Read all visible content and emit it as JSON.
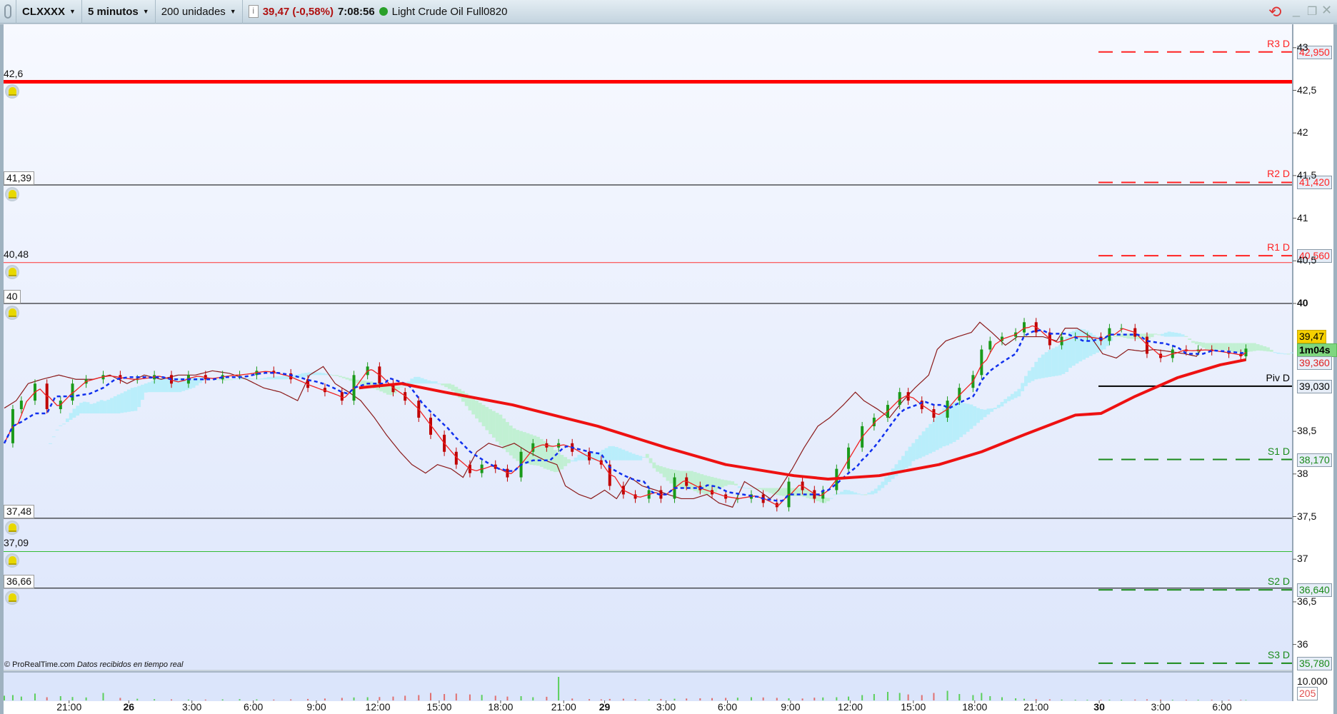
{
  "toolbar": {
    "symbol": "CLXXXX",
    "timeframe": "5 minutos",
    "units": "200 unidades",
    "price": "39,47 (-0,58%)",
    "time": "7:08:56",
    "instrument": "Light Crude Oil Full0820",
    "icons": [
      "link-icon",
      "info-icon",
      "status-dot-icon",
      "refresh-icon",
      "minimize-icon",
      "restore-icon",
      "close-icon"
    ]
  },
  "colors": {
    "up": "#1a9a1a",
    "down": "#c00000",
    "sma": "#ee1111",
    "kijun": "#1030ee",
    "tenkan": "#ee2222",
    "chikou": "#8b1a1a",
    "cloud_up": "#aeeefa",
    "cloud_down": "#b8f0c8"
  },
  "alert_lines": [
    {
      "label": "42,6",
      "price": 42.6,
      "color": "#ff0000",
      "width": 5,
      "boxed": false
    },
    {
      "label": "41,39",
      "price": 41.39,
      "color": "#000000",
      "width": 1,
      "boxed": true
    },
    {
      "label": "40,48",
      "price": 40.48,
      "color": "#ff3333",
      "width": 1,
      "boxed": false
    },
    {
      "label": "40",
      "price": 40.0,
      "color": "#000000",
      "width": 1,
      "boxed": true
    },
    {
      "label": "37,48",
      "price": 37.48,
      "color": "#000000",
      "width": 1,
      "boxed": true
    },
    {
      "label": "37,09",
      "price": 37.09,
      "color": "#33bb33",
      "width": 1,
      "boxed": false
    },
    {
      "label": "36,66",
      "price": 36.66,
      "color": "#000000",
      "width": 1,
      "boxed": true
    }
  ],
  "pivots": [
    {
      "name": "R3 D",
      "value": "42,950",
      "price": 42.95,
      "color": "#ff2222",
      "dashed": true
    },
    {
      "name": "R2 D",
      "value": "41,420",
      "price": 41.42,
      "color": "#ff2222",
      "dashed": true
    },
    {
      "name": "R1 D",
      "value": "40,560",
      "price": 40.56,
      "color": "#ff2222",
      "dashed": true
    },
    {
      "name": "Piv D",
      "value": "39,030",
      "price": 39.03,
      "color": "#000000",
      "dashed": false
    },
    {
      "name": "S1 D",
      "value": "38,170",
      "price": 38.17,
      "color": "#1a8a1a",
      "dashed": true
    },
    {
      "name": "S2 D",
      "value": "36,640",
      "price": 36.64,
      "color": "#1a8a1a",
      "dashed": true
    },
    {
      "name": "S3 D",
      "value": "35,780",
      "price": 35.78,
      "color": "#1a8a1a",
      "dashed": true
    }
  ],
  "price_axis": {
    "ticks": [
      {
        "t": "43",
        "p": 43
      },
      {
        "t": "42,5",
        "p": 42.5
      },
      {
        "t": "42",
        "p": 42
      },
      {
        "t": "41,5",
        "p": 41.5
      },
      {
        "t": "41",
        "p": 41
      },
      {
        "t": "40,5",
        "p": 40.5
      },
      {
        "t": "40",
        "p": 40
      },
      {
        "t": "38,5",
        "p": 38.5
      },
      {
        "t": "38",
        "p": 38
      },
      {
        "t": "37,5",
        "p": 37.5
      },
      {
        "t": "37",
        "p": 37
      },
      {
        "t": "36,5",
        "p": 36.5
      },
      {
        "t": "36",
        "p": 36
      }
    ],
    "last_price": "39,47",
    "countdown": "1m04s",
    "sma_value": "39,360"
  },
  "volume_axis": {
    "max_label": "10.000",
    "last": "205"
  },
  "footer": {
    "copyright": "© ProRealTime.com",
    "status": "Datos recibidos en tiempo real"
  },
  "chart_data": {
    "type": "candlestick",
    "title": "CLXXXX 5 minutos",
    "time_ticks": [
      {
        "t": "21:00",
        "bar": 38
      },
      {
        "t": "26",
        "bar": 73,
        "bold": true
      },
      {
        "t": "3:00",
        "bar": 110
      },
      {
        "t": "6:00",
        "bar": 146
      },
      {
        "t": "9:00",
        "bar": 183
      },
      {
        "t": "12:00",
        "bar": 219
      },
      {
        "t": "15:00",
        "bar": 255
      },
      {
        "t": "18:00",
        "bar": 291
      },
      {
        "t": "21:00",
        "bar": 328
      },
      {
        "t": "29",
        "bar": 352,
        "bold": true
      },
      {
        "t": "3:00",
        "bar": 388
      },
      {
        "t": "6:00",
        "bar": 424
      },
      {
        "t": "9:00",
        "bar": 461
      },
      {
        "t": "12:00",
        "bar": 496
      },
      {
        "t": "15:00",
        "bar": 533
      },
      {
        "t": "18:00",
        "bar": 569
      },
      {
        "t": "21:00",
        "bar": 605
      },
      {
        "t": "30",
        "bar": 642,
        "bold": true
      },
      {
        "t": "3:00",
        "bar": 678
      },
      {
        "t": "6:00",
        "bar": 714
      }
    ],
    "bars": [
      0,
      5,
      10,
      18,
      25,
      33,
      40,
      48,
      58,
      68,
      78,
      88,
      98,
      108,
      118,
      128,
      138,
      148,
      158,
      168,
      178,
      188,
      198,
      205,
      213,
      220,
      228,
      235,
      243,
      250,
      258,
      265,
      273,
      280,
      288,
      295,
      303,
      310,
      318,
      325,
      333,
      343,
      350,
      355,
      363,
      370,
      378,
      385,
      393,
      400,
      408,
      415,
      423,
      430,
      438,
      445,
      453,
      460,
      468,
      475,
      480,
      488,
      495,
      503,
      510,
      518,
      525,
      530,
      538,
      545,
      553,
      560,
      568,
      573,
      578,
      585,
      593,
      598,
      605,
      613,
      620,
      628,
      635,
      643,
      648,
      655,
      663,
      670,
      678,
      685,
      693,
      700,
      708,
      718,
      725,
      728
    ],
    "close": [
      38.36,
      38.76,
      38.86,
      39.06,
      38.76,
      38.86,
      39.06,
      39.11,
      39.16,
      39.11,
      39.11,
      39.16,
      39.06,
      39.16,
      39.11,
      39.16,
      39.16,
      39.21,
      39.18,
      39.11,
      39.01,
      38.96,
      38.86,
      39.16,
      39.26,
      39.06,
      38.96,
      38.86,
      38.66,
      38.46,
      38.26,
      38.11,
      38.01,
      38.11,
      38.06,
      37.96,
      38.26,
      38.36,
      38.31,
      38.36,
      38.26,
      38.16,
      38.11,
      37.86,
      37.76,
      37.71,
      37.81,
      37.71,
      37.96,
      37.86,
      37.81,
      37.76,
      37.71,
      37.71,
      37.76,
      37.66,
      37.61,
      37.91,
      37.81,
      37.71,
      37.81,
      38.06,
      38.31,
      38.56,
      38.66,
      38.81,
      38.96,
      38.86,
      38.76,
      38.66,
      38.86,
      39.01,
      39.16,
      39.46,
      39.56,
      39.61,
      39.66,
      39.78,
      39.66,
      39.51,
      39.61,
      39.61,
      39.61,
      39.56,
      39.71,
      39.71,
      39.61,
      39.41,
      39.36,
      39.46,
      39.44,
      39.46,
      39.44,
      39.41,
      39.38,
      39.47
    ],
    "volume": [
      2200,
      2500,
      1800,
      3200,
      1500,
      2000,
      1600,
      1400,
      3500,
      1200,
      800,
      600,
      500,
      400,
      400,
      500,
      600,
      500,
      400,
      500,
      700,
      900,
      1200,
      1400,
      1500,
      1600,
      1800,
      2200,
      2500,
      3500,
      3000,
      3200,
      2800,
      2600,
      2200,
      1800,
      2000,
      1500,
      1700,
      11000,
      900,
      600,
      500,
      700,
      800,
      600,
      500,
      700,
      800,
      900,
      1000,
      1100,
      1200,
      1300,
      1500,
      1400,
      1200,
      1000,
      900,
      1300,
      1400,
      1500,
      1800,
      2500,
      3000,
      4000,
      3500,
      2800,
      2500,
      3500,
      4500,
      3000,
      2500,
      3500,
      2000,
      1500,
      1000,
      800,
      600,
      500,
      400,
      300,
      300,
      300,
      300,
      300,
      400,
      500,
      400,
      300,
      300,
      300,
      300,
      300,
      250,
      205
    ],
    "sma_bars": [
      208,
      233,
      258,
      298,
      348,
      388,
      423,
      463,
      483,
      513,
      548,
      573,
      598,
      628,
      643,
      663,
      688,
      713,
      728
    ],
    "sma": [
      39.01,
      39.06,
      38.96,
      38.81,
      38.56,
      38.31,
      38.11,
      37.98,
      37.94,
      37.98,
      38.11,
      38.26,
      38.46,
      38.69,
      38.71,
      38.91,
      39.13,
      39.28,
      39.34
    ],
    "ylim": [
      35.6,
      43.1
    ]
  }
}
